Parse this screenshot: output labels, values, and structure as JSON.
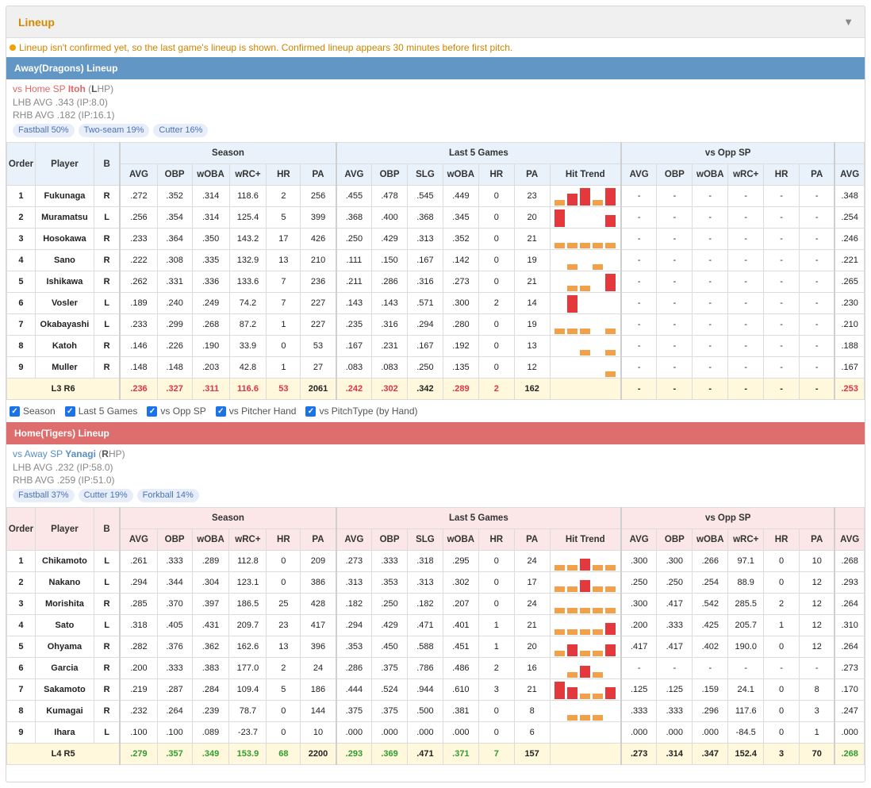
{
  "panel": {
    "title": "Lineup",
    "collapse_icon": "▼"
  },
  "notice": "Lineup isn't confirmed yet, so the last game's lineup is shown. Confirmed lineup appears 30 minutes before first pitch.",
  "headers": {
    "order": "Order",
    "player": "Player",
    "bats": "B",
    "groups": [
      "Season",
      "Last 5 Games",
      "vs Opp SP"
    ],
    "season_cols": [
      "AVG",
      "OBP",
      "wOBA",
      "wRC+",
      "HR",
      "PA"
    ],
    "last5_cols": [
      "AVG",
      "OBP",
      "SLG",
      "wOBA",
      "HR",
      "PA",
      "Hit Trend"
    ],
    "opp_cols": [
      "AVG",
      "OBP",
      "wOBA",
      "wRC+",
      "HR",
      "PA"
    ],
    "extra_col": "AVG"
  },
  "colors": {
    "trend_hit": "#f3a04a",
    "trend_multi": "#e4393c",
    "away": "#6296c5",
    "home": "#de6e6e"
  },
  "toggles": [
    "Season",
    "Last 5 Games",
    "vs Opp SP",
    "vs Pitcher Hand",
    "vs PitchType (by Hand)"
  ],
  "away": {
    "title": "Away(Dragons) Lineup",
    "sp_prefix": "vs Home SP ",
    "sp_name": "Itoh",
    "sp_hand_open": " (",
    "sp_hand": "L",
    "sp_hand_close": "HP)",
    "lhb": "LHB AVG .343 (IP:8.0)",
    "rhb": "RHB AVG .182 (IP:16.1)",
    "pitches": [
      "Fastball 50%",
      "Two-seam 19%",
      "Cutter 16%"
    ],
    "rows": [
      {
        "order": "1",
        "name": "Fukunaga",
        "b": "R",
        "s": [
          ".272",
          ".352",
          ".314",
          "118.6",
          "2",
          "256"
        ],
        "l": [
          ".455",
          ".478",
          ".545",
          ".449",
          "0",
          "23"
        ],
        "trend": [
          1,
          2,
          3,
          1,
          3
        ],
        "o": [
          "-",
          "-",
          "-",
          "-",
          "-",
          "-"
        ],
        "x": ".348"
      },
      {
        "order": "2",
        "name": "Muramatsu",
        "b": "L",
        "s": [
          ".256",
          ".354",
          ".314",
          "125.4",
          "5",
          "399"
        ],
        "l": [
          ".368",
          ".400",
          ".368",
          ".345",
          "0",
          "20"
        ],
        "trend": [
          3,
          0,
          0,
          0,
          2
        ],
        "o": [
          "-",
          "-",
          "-",
          "-",
          "-",
          "-"
        ],
        "x": ".254"
      },
      {
        "order": "3",
        "name": "Hosokawa",
        "b": "R",
        "s": [
          ".233",
          ".364",
          ".350",
          "143.2",
          "17",
          "426"
        ],
        "l": [
          ".250",
          ".429",
          ".313",
          ".352",
          "0",
          "21"
        ],
        "trend": [
          1,
          1,
          1,
          1,
          1
        ],
        "o": [
          "-",
          "-",
          "-",
          "-",
          "-",
          "-"
        ],
        "x": ".246"
      },
      {
        "order": "4",
        "name": "Sano",
        "b": "R",
        "s": [
          ".222",
          ".308",
          ".335",
          "132.9",
          "13",
          "210"
        ],
        "l": [
          ".111",
          ".150",
          ".167",
          ".142",
          "0",
          "19"
        ],
        "trend": [
          0,
          1,
          0,
          1,
          0
        ],
        "o": [
          "-",
          "-",
          "-",
          "-",
          "-",
          "-"
        ],
        "x": ".221"
      },
      {
        "order": "5",
        "name": "Ishikawa",
        "b": "R",
        "s": [
          ".262",
          ".331",
          ".336",
          "133.6",
          "7",
          "236"
        ],
        "l": [
          ".211",
          ".286",
          ".316",
          ".273",
          "0",
          "21"
        ],
        "trend": [
          0,
          1,
          1,
          0,
          3
        ],
        "o": [
          "-",
          "-",
          "-",
          "-",
          "-",
          "-"
        ],
        "x": ".265"
      },
      {
        "order": "6",
        "name": "Vosler",
        "b": "L",
        "s": [
          ".189",
          ".240",
          ".249",
          "74.2",
          "7",
          "227"
        ],
        "l": [
          ".143",
          ".143",
          ".571",
          ".300",
          "2",
          "14"
        ],
        "trend": [
          0,
          3,
          0,
          0,
          0
        ],
        "o": [
          "-",
          "-",
          "-",
          "-",
          "-",
          "-"
        ],
        "x": ".230"
      },
      {
        "order": "7",
        "name": "Okabayashi",
        "b": "L",
        "s": [
          ".233",
          ".299",
          ".268",
          "87.2",
          "1",
          "227"
        ],
        "l": [
          ".235",
          ".316",
          ".294",
          ".280",
          "0",
          "19"
        ],
        "trend": [
          1,
          1,
          1,
          0,
          1
        ],
        "o": [
          "-",
          "-",
          "-",
          "-",
          "-",
          "-"
        ],
        "x": ".210"
      },
      {
        "order": "8",
        "name": "Katoh",
        "b": "R",
        "s": [
          ".146",
          ".226",
          ".190",
          "33.9",
          "0",
          "53"
        ],
        "l": [
          ".167",
          ".231",
          ".167",
          ".192",
          "0",
          "13"
        ],
        "trend": [
          0,
          0,
          1,
          0,
          1
        ],
        "o": [
          "-",
          "-",
          "-",
          "-",
          "-",
          "-"
        ],
        "x": ".188"
      },
      {
        "order": "9",
        "name": "Muller",
        "b": "R",
        "s": [
          ".148",
          ".148",
          ".203",
          "42.8",
          "1",
          "27"
        ],
        "l": [
          ".083",
          ".083",
          ".250",
          ".135",
          "0",
          "12"
        ],
        "trend": [
          0,
          0,
          0,
          0,
          1
        ],
        "o": [
          "-",
          "-",
          "-",
          "-",
          "-",
          "-"
        ],
        "x": ".167"
      }
    ],
    "total": {
      "label_l": "L3 ",
      "label_r": "R",
      "label_rv": "6",
      "s": [
        ".236",
        ".327",
        ".311",
        "116.6",
        "53",
        "2061"
      ],
      "l": [
        ".242",
        ".302",
        ".342",
        ".289",
        "2",
        "162"
      ],
      "o": [
        "-",
        "-",
        "-",
        "-",
        "-",
        "-"
      ],
      "x": ".253"
    }
  },
  "home": {
    "title": "Home(Tigers) Lineup",
    "sp_prefix": "vs Away SP ",
    "sp_name": "Yanagi",
    "sp_hand_open": " (",
    "sp_hand": "R",
    "sp_hand_close": "HP)",
    "lhb": "LHB AVG .232 (IP:58.0)",
    "rhb": "RHB AVG .259 (IP:51.0)",
    "pitches": [
      "Fastball 37%",
      "Cutter 19%",
      "Forkball 14%"
    ],
    "rows": [
      {
        "order": "1",
        "name": "Chikamoto",
        "b": "L",
        "s": [
          ".261",
          ".333",
          ".289",
          "112.8",
          "0",
          "209"
        ],
        "l": [
          ".273",
          ".333",
          ".318",
          ".295",
          "0",
          "24"
        ],
        "trend": [
          1,
          1,
          2,
          1,
          1
        ],
        "o": [
          ".300",
          ".300",
          ".266",
          "97.1",
          "0",
          "10"
        ],
        "x": ".268"
      },
      {
        "order": "2",
        "name": "Nakano",
        "b": "L",
        "s": [
          ".294",
          ".344",
          ".304",
          "123.1",
          "0",
          "386"
        ],
        "l": [
          ".313",
          ".353",
          ".313",
          ".302",
          "0",
          "17"
        ],
        "trend": [
          1,
          1,
          2,
          1,
          1
        ],
        "o": [
          ".250",
          ".250",
          ".254",
          "88.9",
          "0",
          "12"
        ],
        "x": ".293"
      },
      {
        "order": "3",
        "name": "Morishita",
        "b": "R",
        "s": [
          ".285",
          ".370",
          ".397",
          "186.5",
          "25",
          "428"
        ],
        "l": [
          ".182",
          ".250",
          ".182",
          ".207",
          "0",
          "24"
        ],
        "trend": [
          1,
          1,
          1,
          1,
          1
        ],
        "o": [
          ".300",
          ".417",
          ".542",
          "285.5",
          "2",
          "12"
        ],
        "x": ".264"
      },
      {
        "order": "4",
        "name": "Sato",
        "b": "L",
        "s": [
          ".318",
          ".405",
          ".431",
          "209.7",
          "23",
          "417"
        ],
        "l": [
          ".294",
          ".429",
          ".471",
          ".401",
          "1",
          "21"
        ],
        "trend": [
          1,
          1,
          1,
          1,
          2
        ],
        "o": [
          ".200",
          ".333",
          ".425",
          "205.7",
          "1",
          "12"
        ],
        "x": ".310"
      },
      {
        "order": "5",
        "name": "Ohyama",
        "b": "R",
        "s": [
          ".282",
          ".376",
          ".362",
          "162.6",
          "13",
          "396"
        ],
        "l": [
          ".353",
          ".450",
          ".588",
          ".451",
          "1",
          "20"
        ],
        "trend": [
          1,
          2,
          1,
          1,
          2
        ],
        "o": [
          ".417",
          ".417",
          ".402",
          "190.0",
          "0",
          "12"
        ],
        "x": ".264"
      },
      {
        "order": "6",
        "name": "Garcia",
        "b": "R",
        "s": [
          ".200",
          ".333",
          ".383",
          "177.0",
          "2",
          "24"
        ],
        "l": [
          ".286",
          ".375",
          ".786",
          ".486",
          "2",
          "16"
        ],
        "trend": [
          0,
          1,
          2,
          1,
          0
        ],
        "o": [
          "-",
          "-",
          "-",
          "-",
          "-",
          "-"
        ],
        "x": ".273"
      },
      {
        "order": "7",
        "name": "Sakamoto",
        "b": "R",
        "s": [
          ".219",
          ".287",
          ".284",
          "109.4",
          "5",
          "186"
        ],
        "l": [
          ".444",
          ".524",
          ".944",
          ".610",
          "3",
          "21"
        ],
        "trend": [
          3,
          2,
          1,
          1,
          2
        ],
        "o": [
          ".125",
          ".125",
          ".159",
          "24.1",
          "0",
          "8"
        ],
        "x": ".170"
      },
      {
        "order": "8",
        "name": "Kumagai",
        "b": "R",
        "s": [
          ".232",
          ".264",
          ".239",
          "78.7",
          "0",
          "144"
        ],
        "l": [
          ".375",
          ".375",
          ".500",
          ".381",
          "0",
          "8"
        ],
        "trend": [
          0,
          1,
          1,
          1,
          0
        ],
        "o": [
          ".333",
          ".333",
          ".296",
          "117.6",
          "0",
          "3"
        ],
        "x": ".247"
      },
      {
        "order": "9",
        "name": "Ihara",
        "b": "L",
        "s": [
          ".100",
          ".100",
          ".089",
          "-23.7",
          "0",
          "10"
        ],
        "l": [
          ".000",
          ".000",
          ".000",
          ".000",
          "0",
          "6"
        ],
        "trend": [
          0,
          0,
          0,
          0,
          0
        ],
        "o": [
          ".000",
          ".000",
          ".000",
          "-84.5",
          "0",
          "1"
        ],
        "x": ".000"
      }
    ],
    "total": {
      "label_l": "L4 ",
      "label_r": "R",
      "label_rv": "5",
      "s": [
        ".279",
        ".357",
        ".349",
        "153.9",
        "68",
        "2200"
      ],
      "l": [
        ".293",
        ".369",
        ".471",
        ".371",
        "7",
        "157"
      ],
      "o": [
        ".273",
        ".314",
        ".347",
        "152.4",
        "3",
        "70"
      ],
      "x": ".268"
    }
  }
}
